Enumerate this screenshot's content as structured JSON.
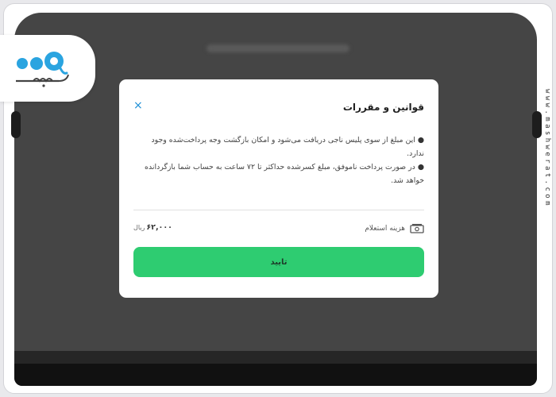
{
  "brand": {
    "logo_text": "مشورت",
    "watermark": "www.mashwerat.com",
    "accent_color": "#2ecc71",
    "logo_color": "#2aa4e0"
  },
  "modal": {
    "title": "قوانین و مقررات",
    "close_icon": "×",
    "paragraphs": [
      "این مبلغ از سوی پلیس ناجی دریافت می‌شود و امکان بازگشت وجه پرداخت‌شده وجود ندارد.",
      "در صورت پرداخت ناموفق، مبلغ کسرشده حداکثر تا ۷۲ ساعت به حساب شما بازگردانده خواهد شد."
    ],
    "cost": {
      "label": "هزینه استعلام",
      "amount": "۶۲,۰۰۰",
      "unit": "ریال",
      "icon": "money-icon"
    },
    "confirm_label": "تایید"
  }
}
